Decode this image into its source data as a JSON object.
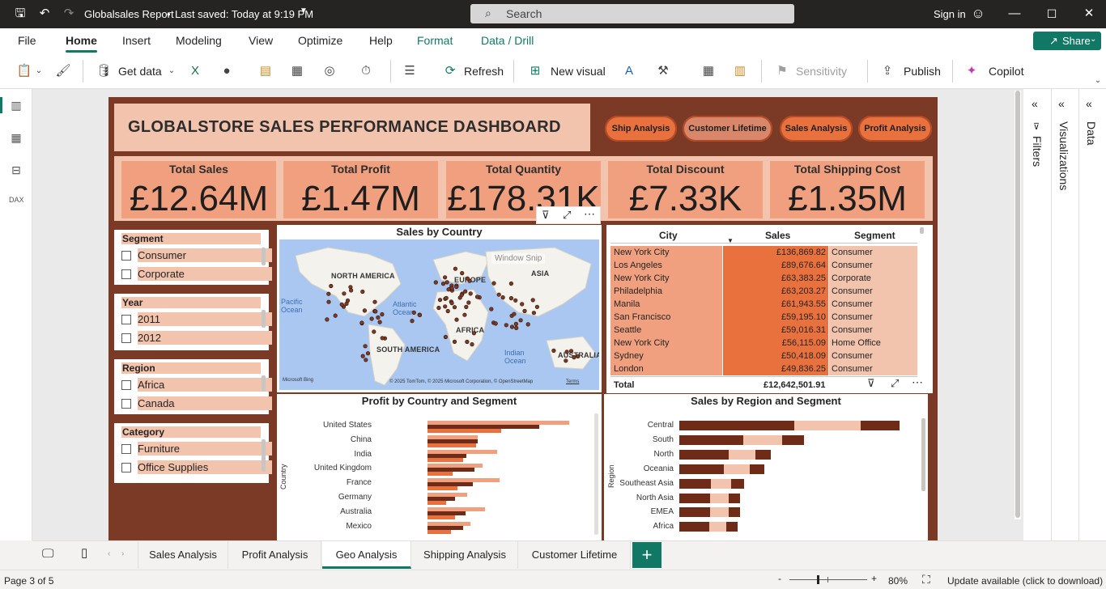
{
  "titlebar": {
    "doc_title": "Globalsales Report",
    "saved": "Last saved: Today at 9:19 PM",
    "search_placeholder": "Search",
    "signin": "Sign in"
  },
  "menu": {
    "items": [
      "File",
      "Home",
      "Insert",
      "Modeling",
      "View",
      "Optimize",
      "Help",
      "Format",
      "Data / Drill"
    ],
    "share": "Share"
  },
  "ribbon": {
    "get_data": "Get data",
    "refresh": "Refresh",
    "new_visual": "New visual",
    "sensitivity": "Sensitivity",
    "publish": "Publish",
    "copilot": "Copilot"
  },
  "dashboard": {
    "title": "GLOBALSTORE SALES PERFORMANCE DASHBOARD",
    "nav": [
      "Ship Analysis",
      "Customer Lifetime",
      "Sales Analysis",
      "Profit Analysis"
    ],
    "kpis": [
      {
        "label": "Total Sales",
        "value": "£12.64M"
      },
      {
        "label": "Total Profit",
        "value": "£1.47M"
      },
      {
        "label": "Total Quantity",
        "value": "£178.31K"
      },
      {
        "label": "Total Discount",
        "value": "£7.33K"
      },
      {
        "label": "Total Shipping Cost",
        "value": "£1.35M"
      }
    ],
    "slicers": [
      {
        "title": "Segment",
        "items": [
          "Consumer",
          "Corporate"
        ]
      },
      {
        "title": "Year",
        "items": [
          "2011",
          "2012"
        ]
      },
      {
        "title": "Region",
        "items": [
          "Africa",
          "Canada"
        ]
      },
      {
        "title": "Category",
        "items": [
          "Furniture",
          "Office Supplies"
        ]
      }
    ],
    "map": {
      "title": "Sales by Country",
      "labels": [
        "NORTH AMERICA",
        "EUROPE",
        "ASIA",
        "AFRICA",
        "SOUTH AMERICA",
        "AUSTRALIA"
      ],
      "oceans": [
        "Pacific Ocean",
        "Atlantic Ocean",
        "Indian Ocean"
      ],
      "attribution": "© 2025 TomTom, © 2025 Microsoft Corporation, © OpenStreetMap",
      "terms": "Terms",
      "brand": "Microsoft Bing",
      "watermark": "Window Snip"
    },
    "table": {
      "headers": [
        "City",
        "Sales",
        "Segment"
      ],
      "rows": [
        [
          "New York City",
          "£136,869.82",
          "Consumer"
        ],
        [
          "Los Angeles",
          "£89,676.64",
          "Consumer"
        ],
        [
          "New York City",
          "£63,383.25",
          "Corporate"
        ],
        [
          "Philadelphia",
          "£63,203.27",
          "Consumer"
        ],
        [
          "Manila",
          "£61,943.55",
          "Consumer"
        ],
        [
          "San Francisco",
          "£59,195.10",
          "Consumer"
        ],
        [
          "Seattle",
          "£59,016.31",
          "Consumer"
        ],
        [
          "New York City",
          "£56,115.09",
          "Home Office"
        ],
        [
          "Sydney",
          "£50,418.09",
          "Consumer"
        ],
        [
          "London",
          "£49,836.25",
          "Consumer"
        ]
      ],
      "total_label": "Total",
      "total_value": "£12,642,501.91"
    }
  },
  "chart_data": [
    {
      "type": "bar",
      "title": "Profit by Country and Segment",
      "ylabel": "Country",
      "categories": [
        "United States",
        "China",
        "India",
        "United Kingdom",
        "France",
        "Germany",
        "Australia",
        "Mexico"
      ],
      "series": [
        {
          "values": [
            146,
            52,
            72,
            57,
            74,
            41,
            59,
            44
          ]
        },
        {
          "values": [
            115,
            52,
            40,
            48,
            47,
            28,
            39,
            37
          ]
        },
        {
          "values": [
            76,
            50,
            37,
            26,
            31,
            19,
            28,
            24
          ]
        }
      ],
      "colors": [
        "#f0a07f",
        "#6e2b17",
        "#e9713e"
      ]
    },
    {
      "type": "bar",
      "title": "Sales by Region and Segment",
      "ylabel": "Region",
      "categories": [
        "Central",
        "South",
        "North",
        "Oceania",
        "Southeast Asia",
        "North Asia",
        "EMEA",
        "Africa"
      ],
      "series": [
        {
          "values": [
            142,
            79,
            61,
            55,
            39,
            38,
            38,
            37
          ]
        },
        {
          "values": [
            82,
            48,
            33,
            32,
            25,
            23,
            23,
            21
          ]
        },
        {
          "values": [
            48,
            27,
            19,
            18,
            16,
            14,
            14,
            14
          ]
        }
      ],
      "colors": [
        "#6e2b17",
        "#f3c4ad",
        "#6e2b17"
      ]
    }
  ],
  "tabs": [
    "Sales Analysis",
    "Profit Analysis",
    "Geo Analysis",
    "Shipping Analysis",
    "Customer Lifetime"
  ],
  "panes": {
    "filters": "Filters",
    "visualizations": "Visualizations",
    "data": "Data"
  },
  "status": {
    "page": "Page 3 of 5",
    "zoom": "80%",
    "update": "Update available (click to download)"
  }
}
